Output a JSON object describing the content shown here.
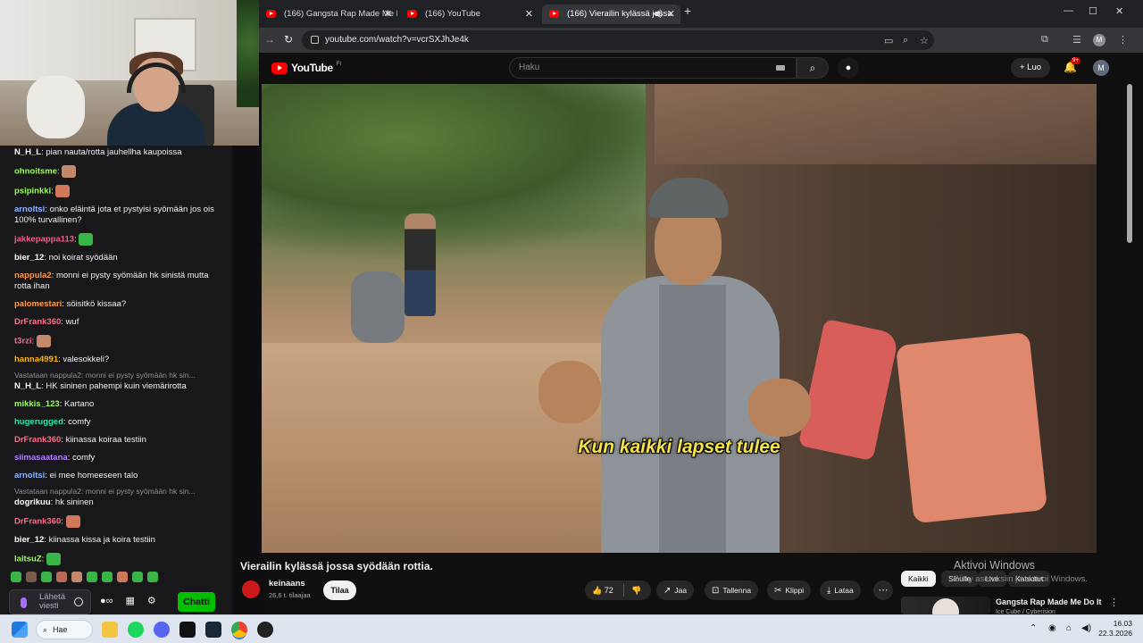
{
  "chat": {
    "messages": [
      {
        "user": "N_H_L",
        "color": "#ffffff",
        "text": "pian nauta/rotta jauhellha kaupoissa"
      },
      {
        "user": "ohnoitsme",
        "color": "#9bff5a",
        "text": ""
      },
      {
        "user": "psipinkki",
        "color": "#9bff5a",
        "text": ""
      },
      {
        "user": "arnoltsi",
        "color": "#8ab4ff",
        "text": "onko eläintä jota et pystyisi syömään jos ois 100% turvallinen?"
      },
      {
        "user": "jakkepappa113",
        "color": "#ff5a8c",
        "text": ""
      },
      {
        "user": "bier_12",
        "color": "#ffffff",
        "text": "noi koirat syödään"
      },
      {
        "user": "nappula2",
        "color": "#ff9a3c",
        "text": "monni ei pysty syömään hk sinistä mutta rotta ihan"
      },
      {
        "user": "palomestari",
        "color": "#ff9a3c",
        "text": "söisitkö kissaa?"
      },
      {
        "user": "DrFrank360",
        "color": "#ff6b8a",
        "text": "wuf"
      },
      {
        "user": "t3rzi",
        "color": "#ff6b8a",
        "text": ""
      },
      {
        "user": "hanna4991",
        "color": "#ffb400",
        "text": "valesokkeli?"
      },
      {
        "user": "N_H_L",
        "color": "#ffffff",
        "text": "HK sininen pahempi kuin viemärirotta",
        "reply": "Vastataan nappula2: monni ei pysty syömään hk sin..."
      },
      {
        "user": "mikkis_123",
        "color": "#9bff5a",
        "text": "Kartano"
      },
      {
        "user": "hugerugged",
        "color": "#2ee6a8",
        "text": "comfy"
      },
      {
        "user": "DrFrank360",
        "color": "#ff6b8a",
        "text": "kiinassa koiraa testiin"
      },
      {
        "user": "siimasaatana",
        "color": "#b37bff",
        "text": "comfy"
      },
      {
        "user": "arnoltsi",
        "color": "#8ab4ff",
        "text": "ei mee homeeseen talo"
      },
      {
        "user": "dogrikuu",
        "color": "#ffffff",
        "text": "hk sininen",
        "reply": "Vastataan nappula2: monni ei pysty syömään hk sin..."
      },
      {
        "user": "DrFrank360",
        "color": "#ff6b8a",
        "text": ""
      },
      {
        "user": "bier_12",
        "color": "#ffffff",
        "text": "kiinassa kissa ja koira testiin"
      },
      {
        "user": "laitsuZ",
        "color": "#9bff5a",
        "text": ""
      }
    ],
    "input_placeholder": "Lähetä viesti",
    "send_label": "Chatti",
    "points": "∞"
  },
  "browser": {
    "tabs": [
      {
        "title": "(166) Gangsta Rap Made Me Do It",
        "active": false
      },
      {
        "title": "(166) YouTube",
        "active": false
      },
      {
        "title": "(166) Vierailin kylässä jossa",
        "active": true
      }
    ],
    "url": "youtube.com/watch?v=vcrSXJhJe4k",
    "profile_initial": "M"
  },
  "youtube": {
    "logo_text": "YouTube",
    "region": "FI",
    "search_placeholder": "Haku",
    "create_label": "Luo",
    "notifications": "9+",
    "avatar_initial": "M",
    "subtitle": "Kun kaikki lapset tulee",
    "video_title": "Vierailin kylässä jossa syödään rottia.",
    "channel_name": "keinaans",
    "subscribers": "26,6 t. tilaajaa",
    "subscribe_label": "Tilaa",
    "likes": "72",
    "actions": {
      "share": "Jaa",
      "save": "Tallenna",
      "clip": "Klippi",
      "download": "Lataa"
    },
    "chips": [
      "Kaikki",
      "Sinulle",
      "Live",
      "Katsotut"
    ],
    "recommendation": {
      "title": "Gangsta Rap Made Me Do It",
      "channel": "Ice Cube / Cyberision"
    }
  },
  "windows": {
    "activate_title": "Aktivoi Windows",
    "activate_sub": "Siirry asetuksiin ja aktivoi Windows.",
    "search_label": "Hae",
    "time": "16.03",
    "date": "22.3.2026"
  }
}
